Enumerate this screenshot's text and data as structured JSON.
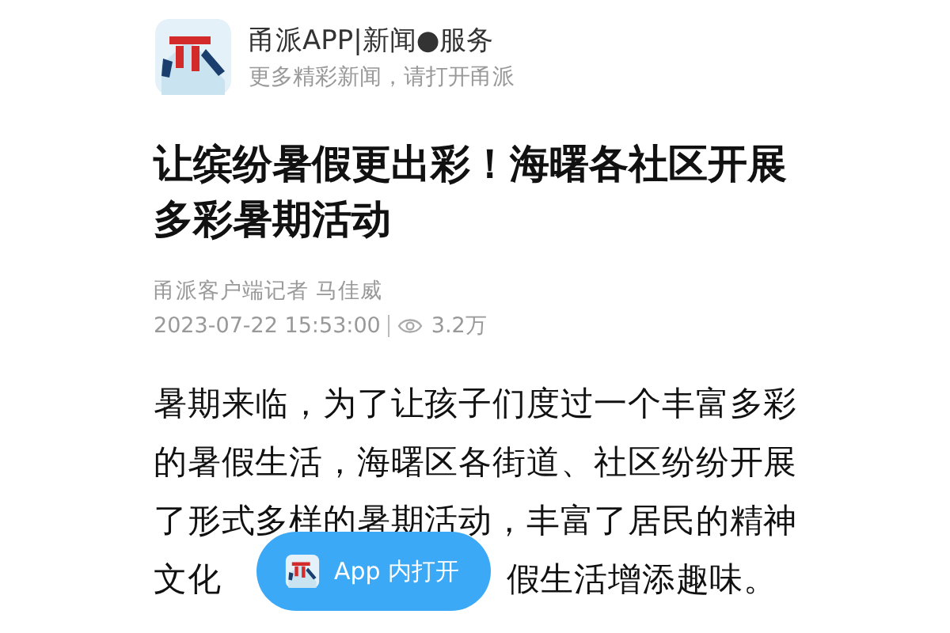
{
  "app_banner": {
    "title": "甬派APP|新闻●服务",
    "subtitle": "更多精彩新闻，请打开甬派"
  },
  "article": {
    "headline": "让缤纷暑假更出彩！海曙各社区开展多彩暑期活动",
    "byline": "甬派客户端记者 马佳威",
    "datetime": "2023-07-22 15:53:00",
    "views": "3.2万",
    "body_lines": [
      "暑期来临，为了让孩子们度过一个丰富多彩",
      "的暑假生活，海曙区各街道、社区纷纷开展",
      "了形式多样的暑期活动，丰富了居民的精神"
    ],
    "last_line_parts": [
      "文化",
      "假生活增添趣味。"
    ]
  },
  "open_button": {
    "label": "App 内打开"
  }
}
